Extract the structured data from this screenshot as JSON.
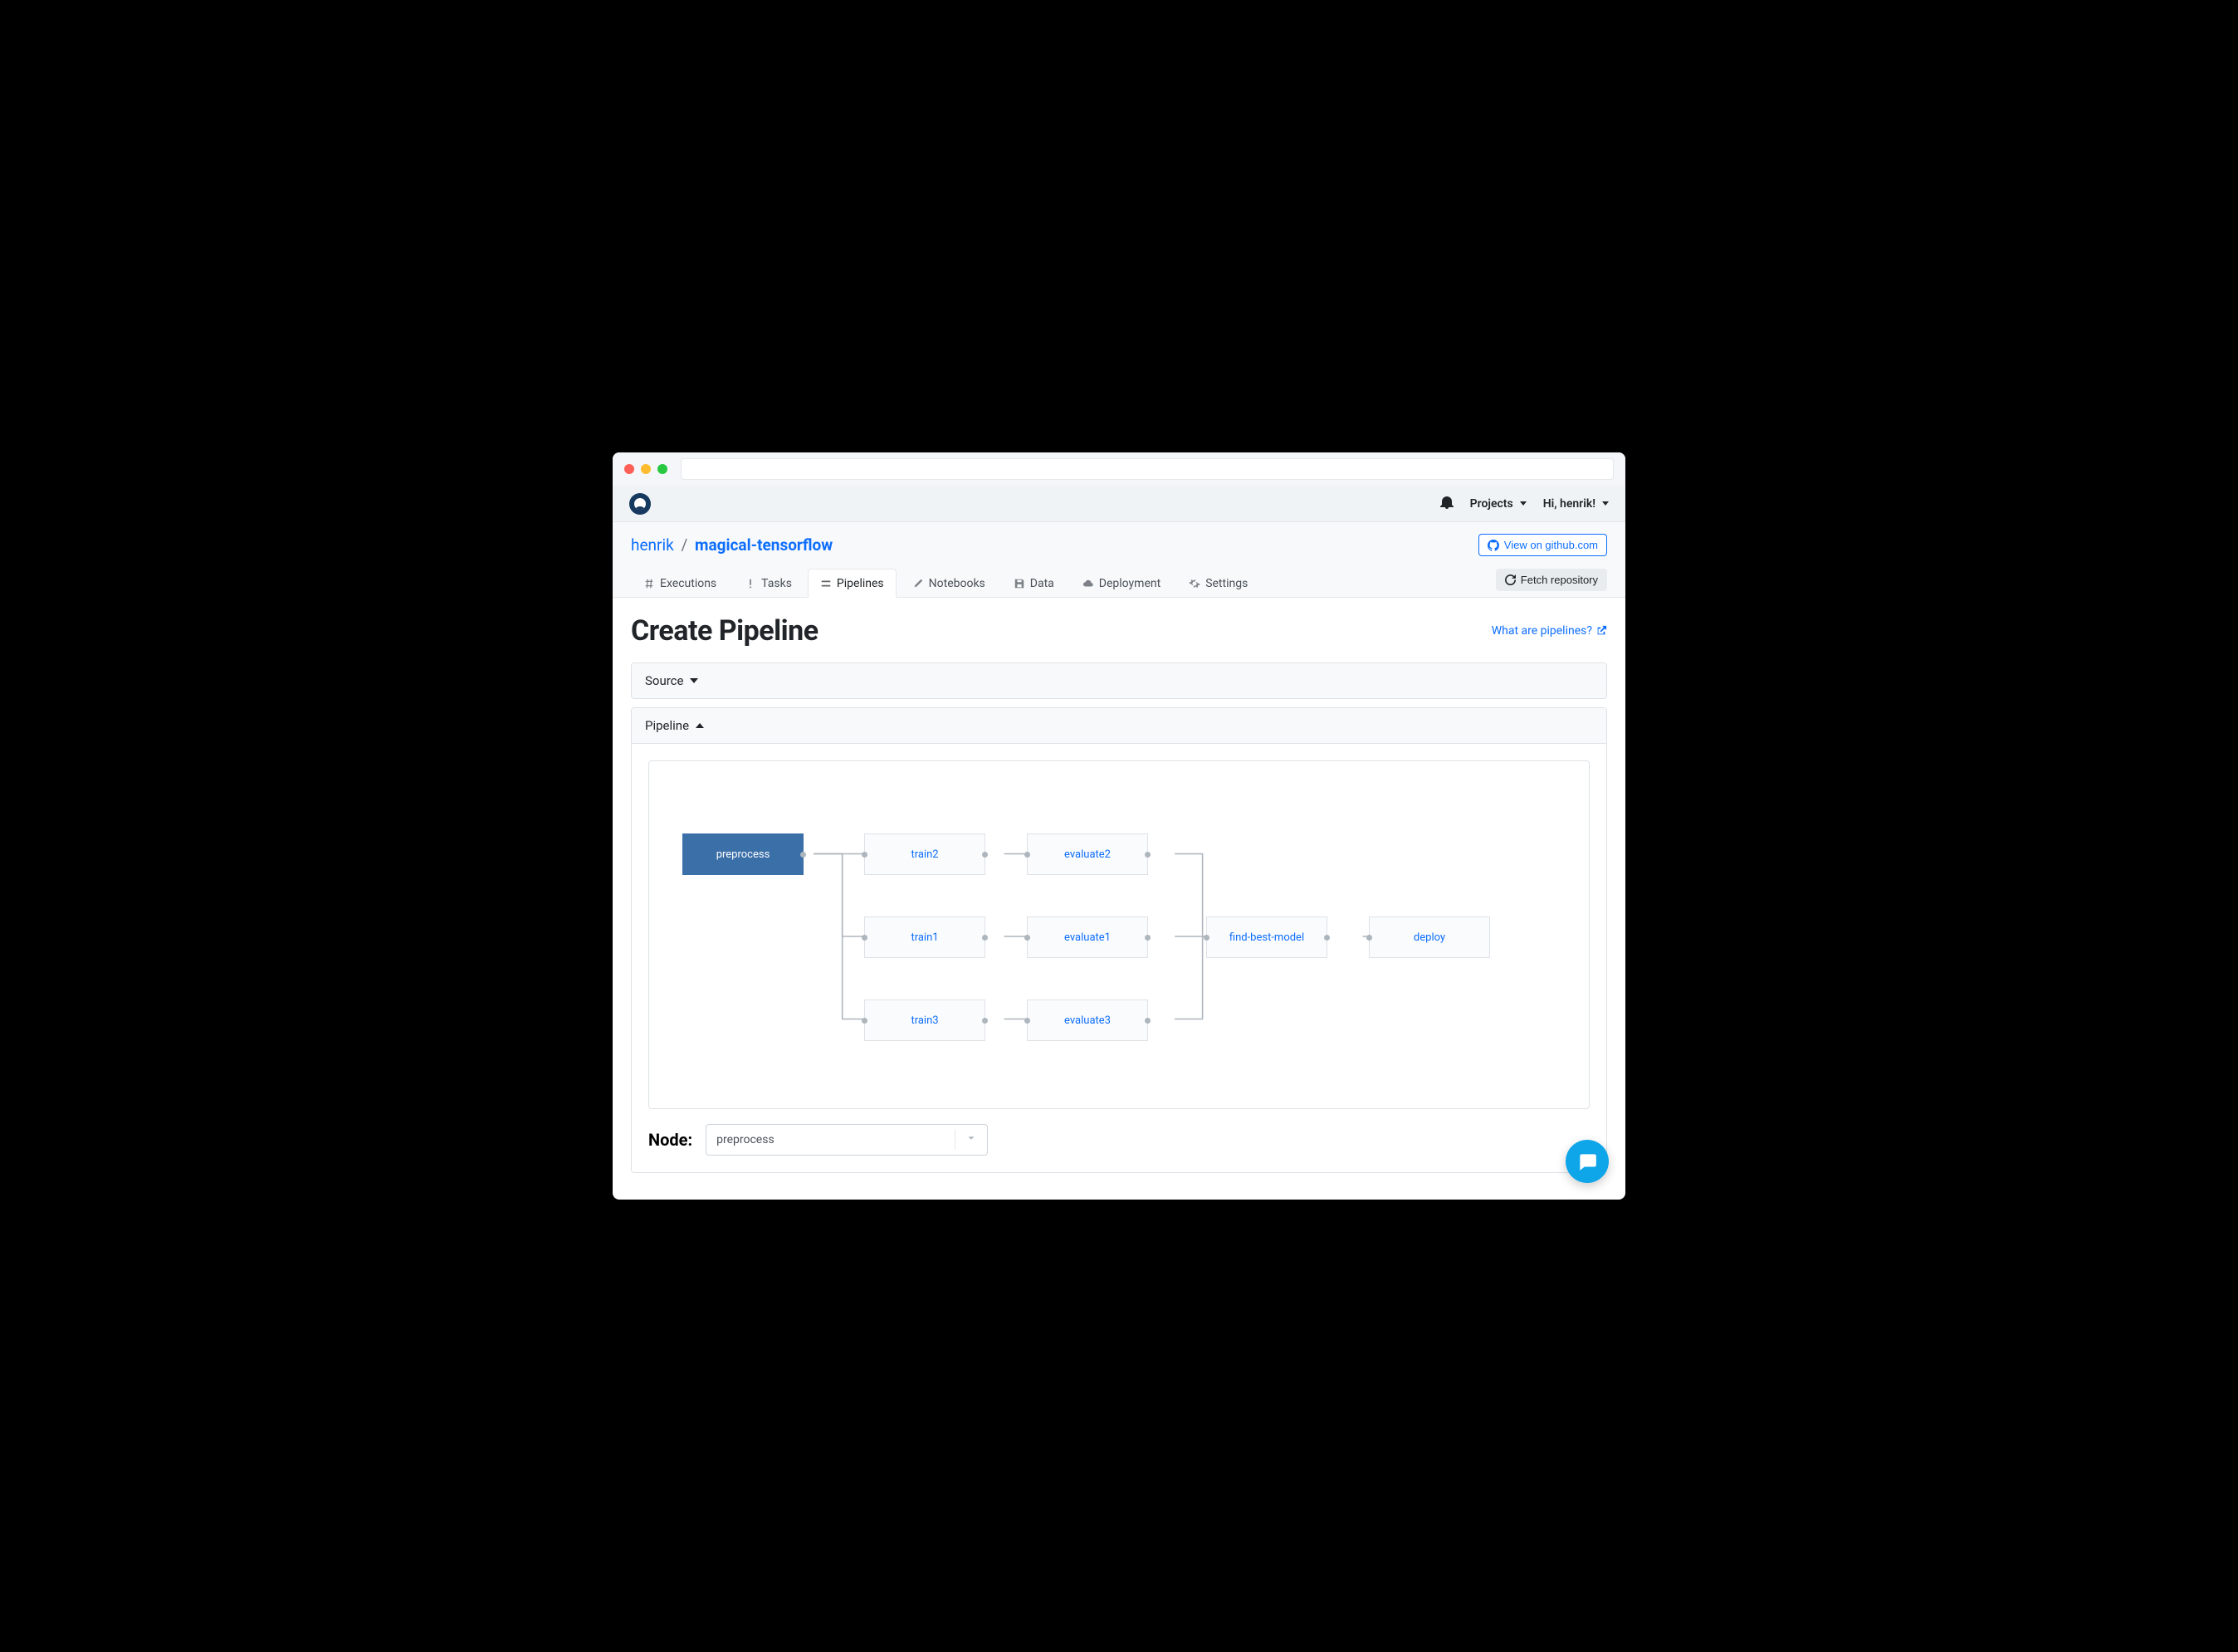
{
  "topnav": {
    "projects": "Projects",
    "greeting": "Hi, henrik!"
  },
  "breadcrumb": {
    "owner": "henrik",
    "sep": "/",
    "repo": "magical-tensorflow"
  },
  "github_button": "View on github.com",
  "fetch_button": "Fetch repository",
  "tabs": {
    "executions": "Executions",
    "tasks": "Tasks",
    "pipelines": "Pipelines",
    "notebooks": "Notebooks",
    "data": "Data",
    "deployment": "Deployment",
    "settings": "Settings"
  },
  "page_title": "Create Pipeline",
  "help_link": "What are pipelines?",
  "panels": {
    "source": "Source",
    "pipeline": "Pipeline"
  },
  "graph": {
    "nodes": {
      "preprocess": "preprocess",
      "train1": "train1",
      "train2": "train2",
      "train3": "train3",
      "evaluate1": "evaluate1",
      "evaluate2": "evaluate2",
      "evaluate3": "evaluate3",
      "find_best_model": "find-best-model",
      "deploy": "deploy"
    }
  },
  "node_section": {
    "label": "Node:",
    "selected": "preprocess"
  }
}
